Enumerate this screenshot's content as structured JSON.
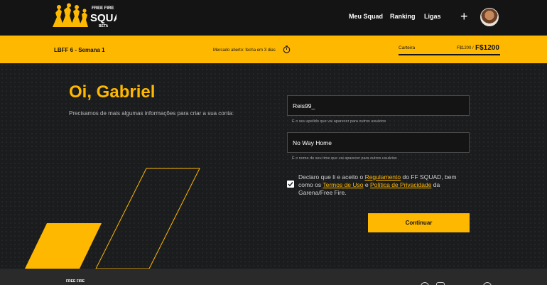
{
  "brand": {
    "logo_text_top": "FREE FIRE",
    "logo_text_main": "SQUAD",
    "logo_text_sub": "BETA"
  },
  "nav": {
    "items": [
      {
        "label": "Meu Squad"
      },
      {
        "label": "Ranking"
      },
      {
        "label": "Ligas"
      }
    ],
    "add_icon": "+"
  },
  "status_bar": {
    "league": "LBFF 6 - Semana 1",
    "market": "Mercado aberto: fecha em 3 dias",
    "wallet_label": "Carteira",
    "wallet_small": "F$1200 /",
    "wallet_big": "F$1200"
  },
  "main": {
    "greeting": "Oi, Gabriel",
    "subtitle": "Precisamos de mais algumas informações para criar a sua conta:",
    "nickname_value": "Reis99_",
    "nickname_hint": "É o seu apelido que vai aparecer para outros usuários",
    "team_value": "No Way Home",
    "team_hint": "É o nome do seu time que vai aparecer para outros usuários",
    "declare_a": "Declaro que li e aceito o ",
    "link_regulamento": "Regulamento",
    "declare_b": " do FF SQUAD, bem como os ",
    "link_termos": "Termos de Uso",
    "declare_c": " e ",
    "link_privacidade": "Política de Privacidade",
    "declare_d": " da Garena/Free Fire.",
    "continue_label": "Continuar"
  },
  "footer": {
    "logo_text": "FREE FIRE"
  },
  "colors": {
    "accent": "#ffb800",
    "background": "#141414"
  }
}
